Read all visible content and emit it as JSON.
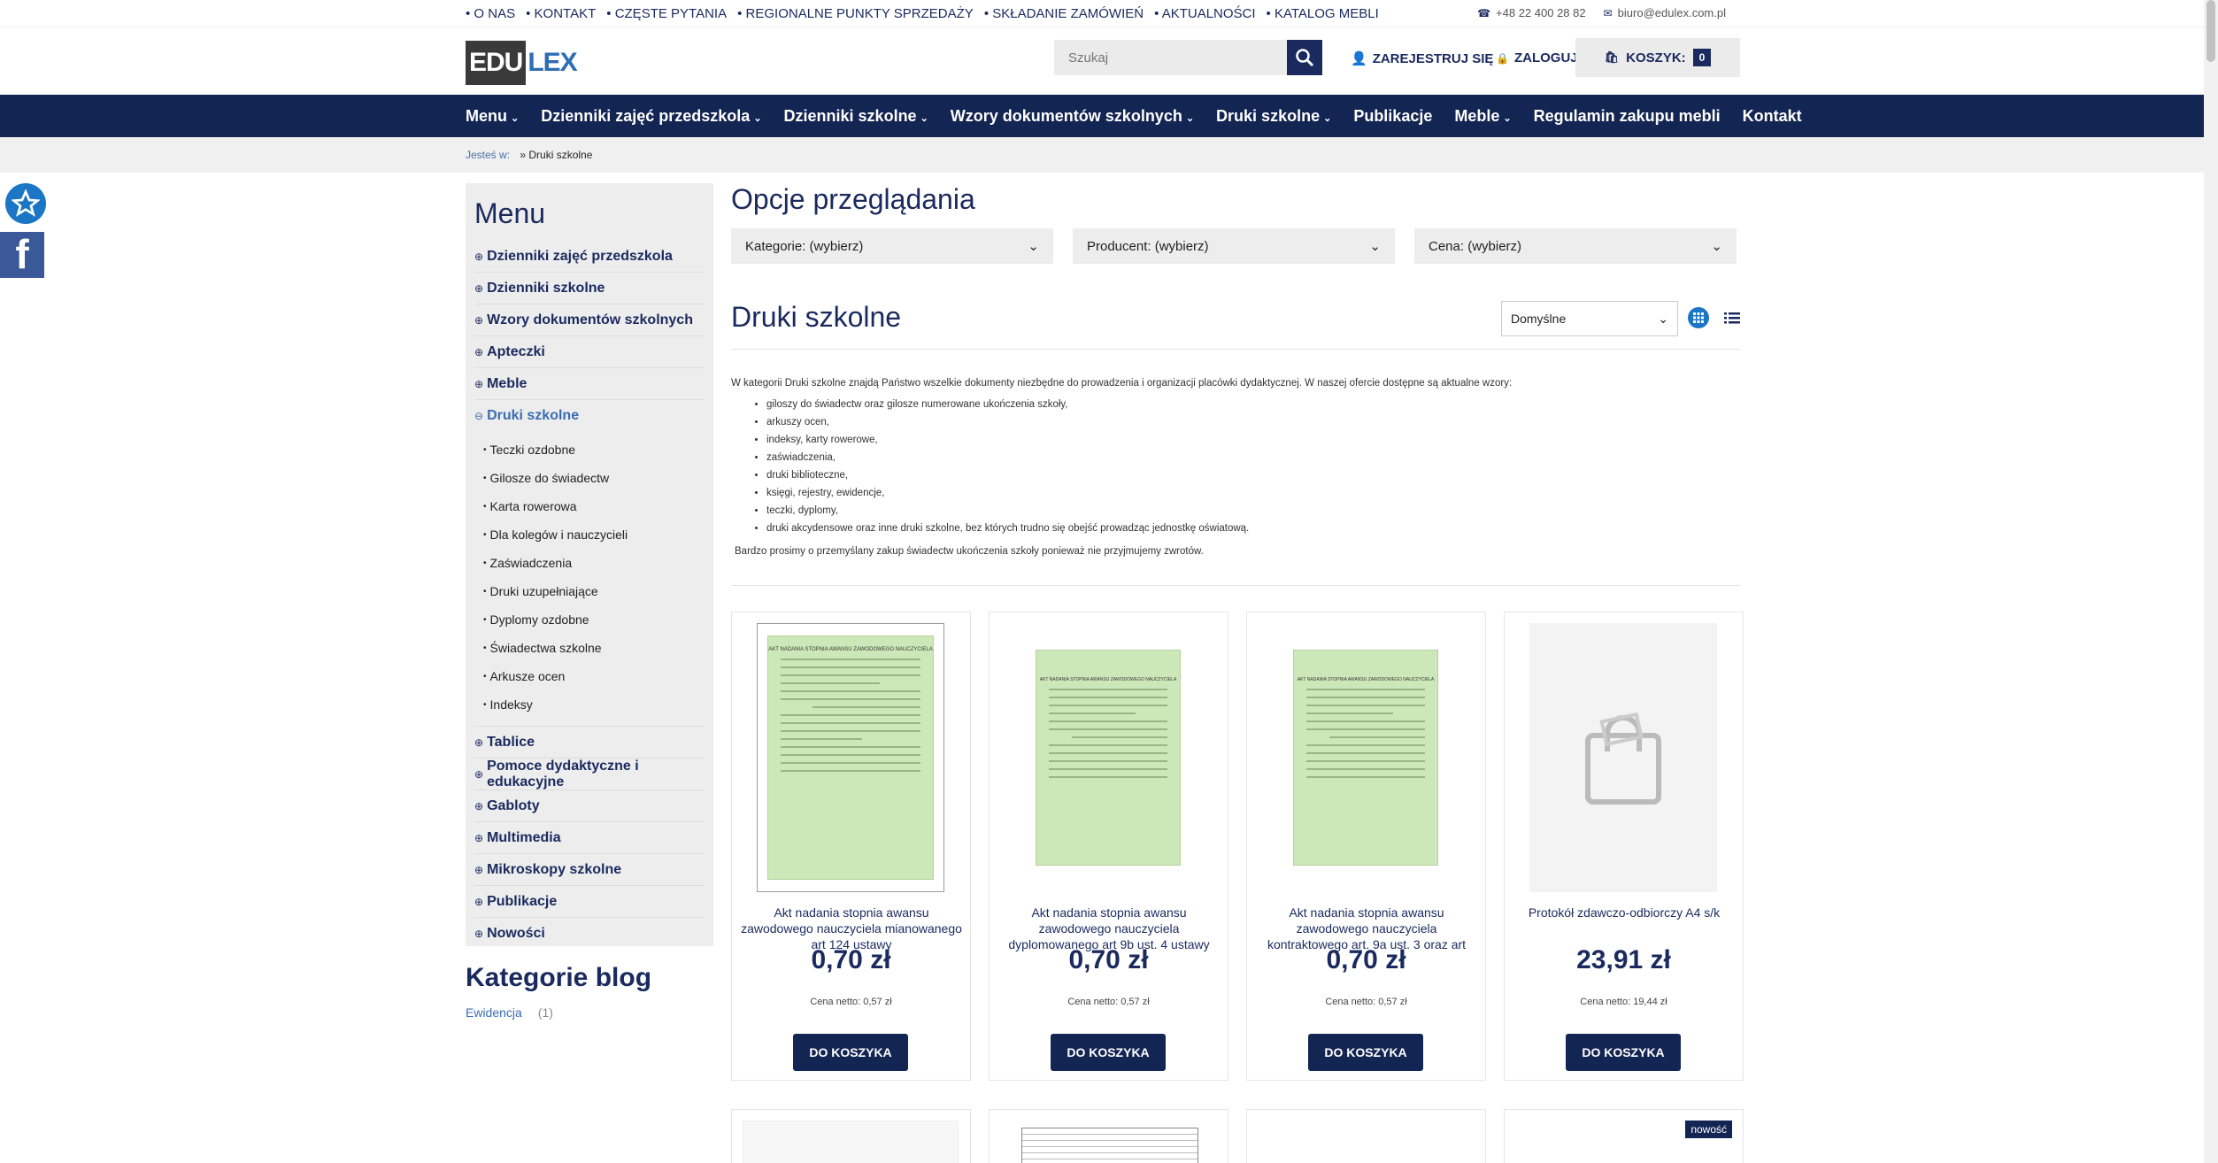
{
  "topbar": {
    "links": [
      "O NAS",
      "KONTAKT",
      "CZĘSTE PYTANIA",
      "REGIONALNE PUNKTY SPRZEDAŻY",
      "SKŁADANIE ZAMÓWIEŃ",
      "AKTUALNOŚCI",
      "KATALOG MEBLI"
    ],
    "phone": "+48 22 400 28 82",
    "email": "biuro@edulex.com.pl"
  },
  "header": {
    "logo_part1": "EDU",
    "logo_part2": "LEX",
    "search_placeholder": "Szukaj",
    "register": "ZAREJESTRUJ SIĘ",
    "login": "ZALOGUJ SIĘ",
    "cart_label": "KOSZYK:",
    "cart_count": "0"
  },
  "nav": {
    "items": [
      "Menu",
      "Dzienniki zajęć przedszkola",
      "Dzienniki szkolne",
      "Wzory dokumentów szkolnych",
      "Druki szkolne",
      "Publikacje",
      "Meble",
      "Regulamin zakupu mebli",
      "Kontakt"
    ]
  },
  "breadcrumb": {
    "label": "Jesteś w:",
    "current": "Druki szkolne"
  },
  "sidebar": {
    "title": "Menu",
    "top_categories": [
      "Dzienniki zajęć przedszkola",
      "Dzienniki szkolne",
      "Wzory dokumentów szkolnych",
      "Apteczki",
      "Meble"
    ],
    "active": "Druki szkolne",
    "subcategories": [
      "Teczki ozdobne",
      "Gilosze do świadectw",
      "Karta rowerowa",
      "Dla kolegów i nauczycieli",
      "Zaświadczenia",
      "Druki uzupełniające",
      "Dyplomy ozdobne",
      "Świadectwa szkolne",
      "Arkusze ocen",
      "Indeksy"
    ],
    "bottom_categories": [
      "Tablice",
      "Pomoce dydaktyczne i edukacyjne",
      "Gabloty",
      "Multimedia",
      "Mikroskopy szkolne",
      "Publikacje",
      "Nowości"
    ]
  },
  "blog": {
    "title": "Kategorie blog",
    "item": "Ewidencja",
    "count": "(1)"
  },
  "main": {
    "options_title": "Opcje przeglądania",
    "filters": [
      "Kategorie: (wybierz)",
      "Producent: (wybierz)",
      "Cena: (wybierz)"
    ],
    "title": "Druki szkolne",
    "sort": "Domyślne",
    "intro": "W kategorii Druki szkolne znajdą Państwo wszelkie dokumenty niezbędne do prowadzenia i organizacji placówki dydaktycznej. W naszej ofercie dostępne są aktualne wzory:",
    "bullets": [
      "giloszy do świadectw oraz gilosze numerowane ukończenia szkoły,",
      "arkuszy ocen,",
      "indeksy, karty rowerowe,",
      "zaświadczenia,",
      "druki biblioteczne,",
      "księgi, rejestry, ewidencje,",
      "teczki, dyplomy,",
      "druki akcydensowe oraz inne druki szkolne, bez których trudno się obejść prowadząc jednostkę oświatową."
    ],
    "note": "Bardzo prosimy o przemyślany zakup świadectw ukończenia szkoły ponieważ nie przyjmujemy zwrotów."
  },
  "products": [
    {
      "name": "Akt nadania stopnia awansu zawodowego nauczyciela mianowanego art 124 ustawy",
      "price": "0,70 zł",
      "net": "Cena netto: 0,57 zł",
      "button": "DO KOSZYKA"
    },
    {
      "name": "Akt nadania stopnia awansu zawodowego nauczyciela dyplomowanego art 9b ust. 4 ustawy",
      "price": "0,70 zł",
      "net": "Cena netto: 0,57 zł",
      "button": "DO KOSZYKA"
    },
    {
      "name": "Akt nadania stopnia awansu zawodowego nauczyciela kontraktowego art. 9a ust. 3 oraz art",
      "price": "0,70 zł",
      "net": "Cena netto: 0,57 zł",
      "button": "DO KOSZYKA"
    },
    {
      "name": "Protokół zdawczo-odbiorczy A4 s/k",
      "price": "23,91 zł",
      "net": "Cena netto: 19,44 zł",
      "button": "DO KOSZYKA"
    }
  ],
  "badge_new": "nowość",
  "doc_heading": "AKT NADANIA STOPNIA AWANSU ZAWODOWEGO NAUCZYCIELA"
}
